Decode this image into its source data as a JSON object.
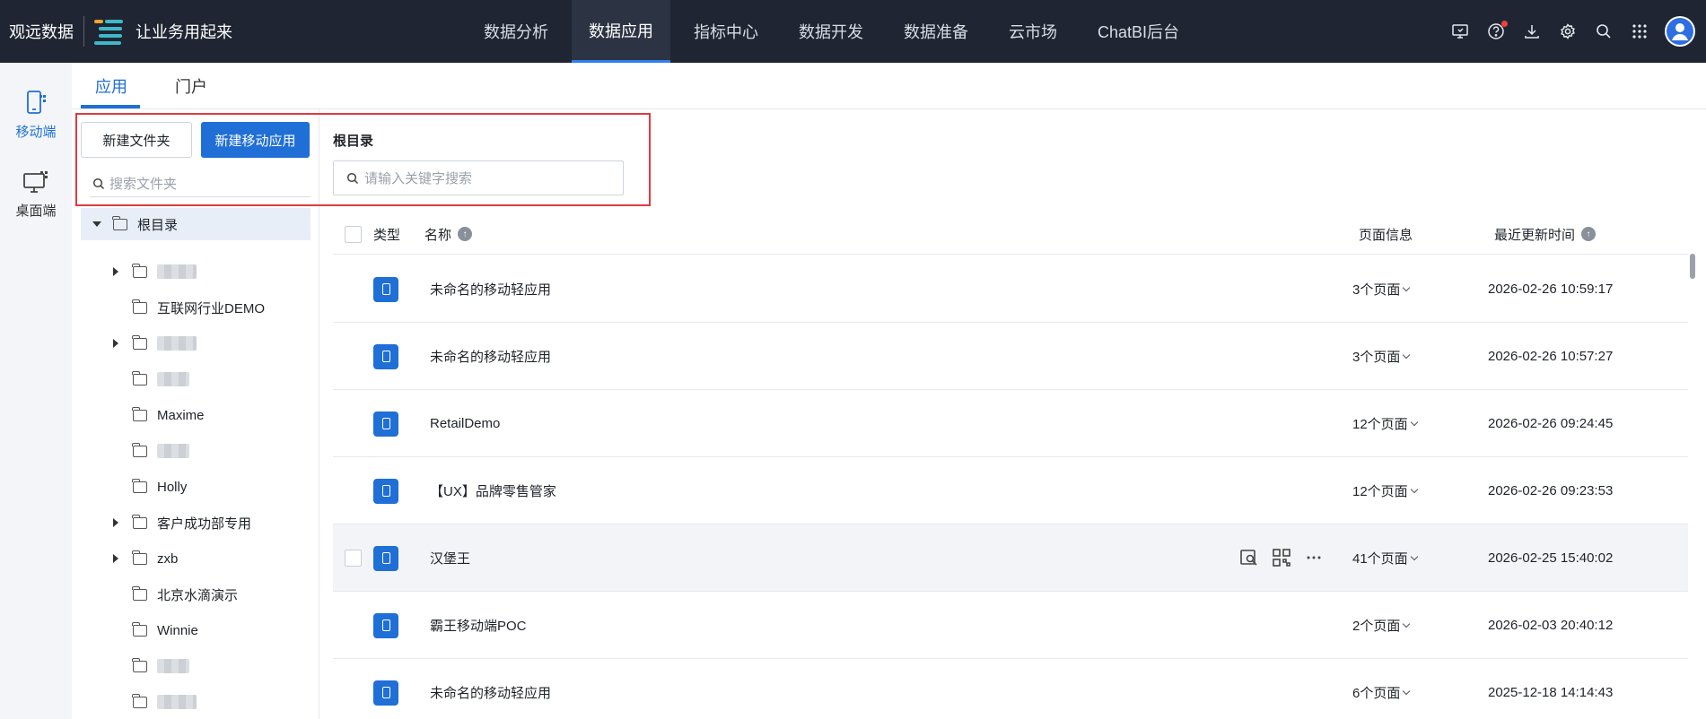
{
  "header": {
    "brand": "观远数据",
    "slogan": "让业务用起来",
    "nav": [
      "数据分析",
      "数据应用",
      "指标中心",
      "数据开发",
      "数据准备",
      "云市场",
      "ChatBI后台"
    ],
    "active_nav": "数据应用",
    "icons": [
      "monitor-icon",
      "help-icon",
      "download-icon",
      "settings-icon",
      "search-icon",
      "apps-grid-icon",
      "avatar"
    ]
  },
  "rail": {
    "mobile": "移动端",
    "desktop": "桌面端"
  },
  "tabs": {
    "app": "应用",
    "portal": "门户"
  },
  "folder_panel": {
    "new_folder": "新建文件夹",
    "new_mobile_app": "新建移动应用",
    "search_placeholder": "搜索文件夹",
    "root": "根目录",
    "items": [
      {
        "label": "",
        "blurred": true,
        "expandable": true
      },
      {
        "label": "互联网行业DEMO",
        "expandable": false
      },
      {
        "label": "",
        "blurred": true,
        "expandable": true
      },
      {
        "label": "",
        "blurred": true,
        "expandable": false
      },
      {
        "label": "Maxime",
        "expandable": false
      },
      {
        "label": "",
        "blurred": true,
        "expandable": false
      },
      {
        "label": "Holly",
        "expandable": false
      },
      {
        "label": "客户成功部专用",
        "expandable": true
      },
      {
        "label": "zxb",
        "expandable": true
      },
      {
        "label": "北京水滴演示",
        "expandable": false
      },
      {
        "label": "Winnie",
        "expandable": false
      },
      {
        "label": "",
        "blurred": true,
        "expandable": false
      },
      {
        "label": "",
        "blurred": true,
        "expandable": false
      }
    ]
  },
  "content": {
    "breadcrumb": "根目录",
    "search_placeholder": "请输入关键字搜索",
    "columns": {
      "type": "类型",
      "name": "名称",
      "pages": "页面信息",
      "updated": "最近更新时间"
    },
    "rows": [
      {
        "name": "未命名的移动轻应用",
        "pages": "3个页面",
        "updated": "2026-02-26 10:59:17"
      },
      {
        "name": "未命名的移动轻应用",
        "pages": "3个页面",
        "updated": "2026-02-26 10:57:27"
      },
      {
        "name": "RetailDemo",
        "pages": "12个页面",
        "updated": "2026-02-26 09:24:45"
      },
      {
        "name": "【UX】品牌零售管家",
        "pages": "12个页面",
        "updated": "2026-02-26 09:23:53"
      },
      {
        "name": "汉堡王",
        "pages": "41个页面",
        "updated": "2026-02-25 15:40:02"
      },
      {
        "name": "霸王移动端POC",
        "pages": "2个页面",
        "updated": "2026-02-03 20:40:12"
      },
      {
        "name": "未命名的移动轻应用",
        "pages": "6个页面",
        "updated": "2025-12-18 14:14:43"
      }
    ],
    "hovered_row": 4,
    "row_actions": [
      "preview-icon",
      "qrcode-icon",
      "more-icon"
    ]
  },
  "colors": {
    "accent": "#1f6fd6",
    "topbar": "#1f2532",
    "highlight": "#e0393e"
  }
}
